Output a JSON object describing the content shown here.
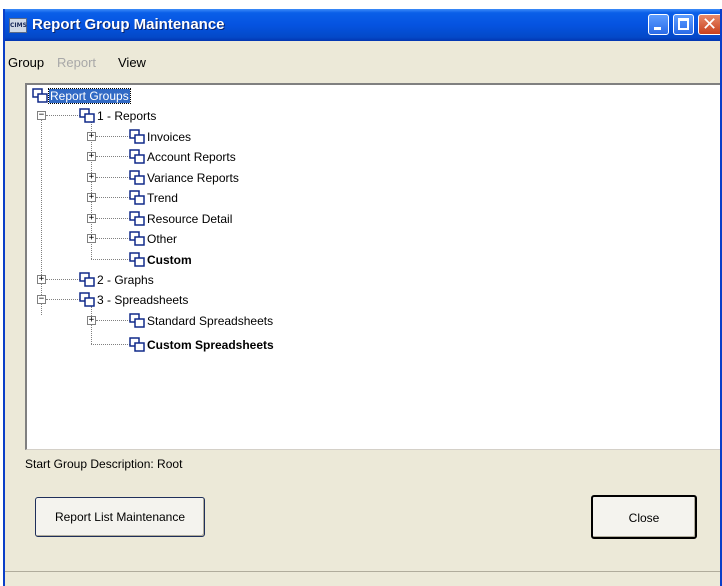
{
  "window": {
    "title": "Report Group Maintenance",
    "app_icon_text": "CIMS"
  },
  "menu": [
    {
      "label": "Group",
      "enabled": true
    },
    {
      "label": "Report",
      "enabled": false
    },
    {
      "label": "View",
      "enabled": true
    }
  ],
  "tree": {
    "root": "Report Groups",
    "reports": "1 - Reports",
    "invoices": "Invoices",
    "account_reports": "Account Reports",
    "variance_reports": "Variance Reports",
    "trend": "Trend",
    "resource_detail": "Resource Detail",
    "other": "Other",
    "custom": "Custom",
    "graphs": "2 - Graphs",
    "spreadsheets": "3 - Spreadsheets",
    "standard_spreadsheets": "Standard Spreadsheets",
    "custom_spreadsheets": "Custom Spreadsheets"
  },
  "description": "Start Group Description: Root",
  "buttons": {
    "report_list": "Report List Maintenance",
    "close": "Close"
  }
}
